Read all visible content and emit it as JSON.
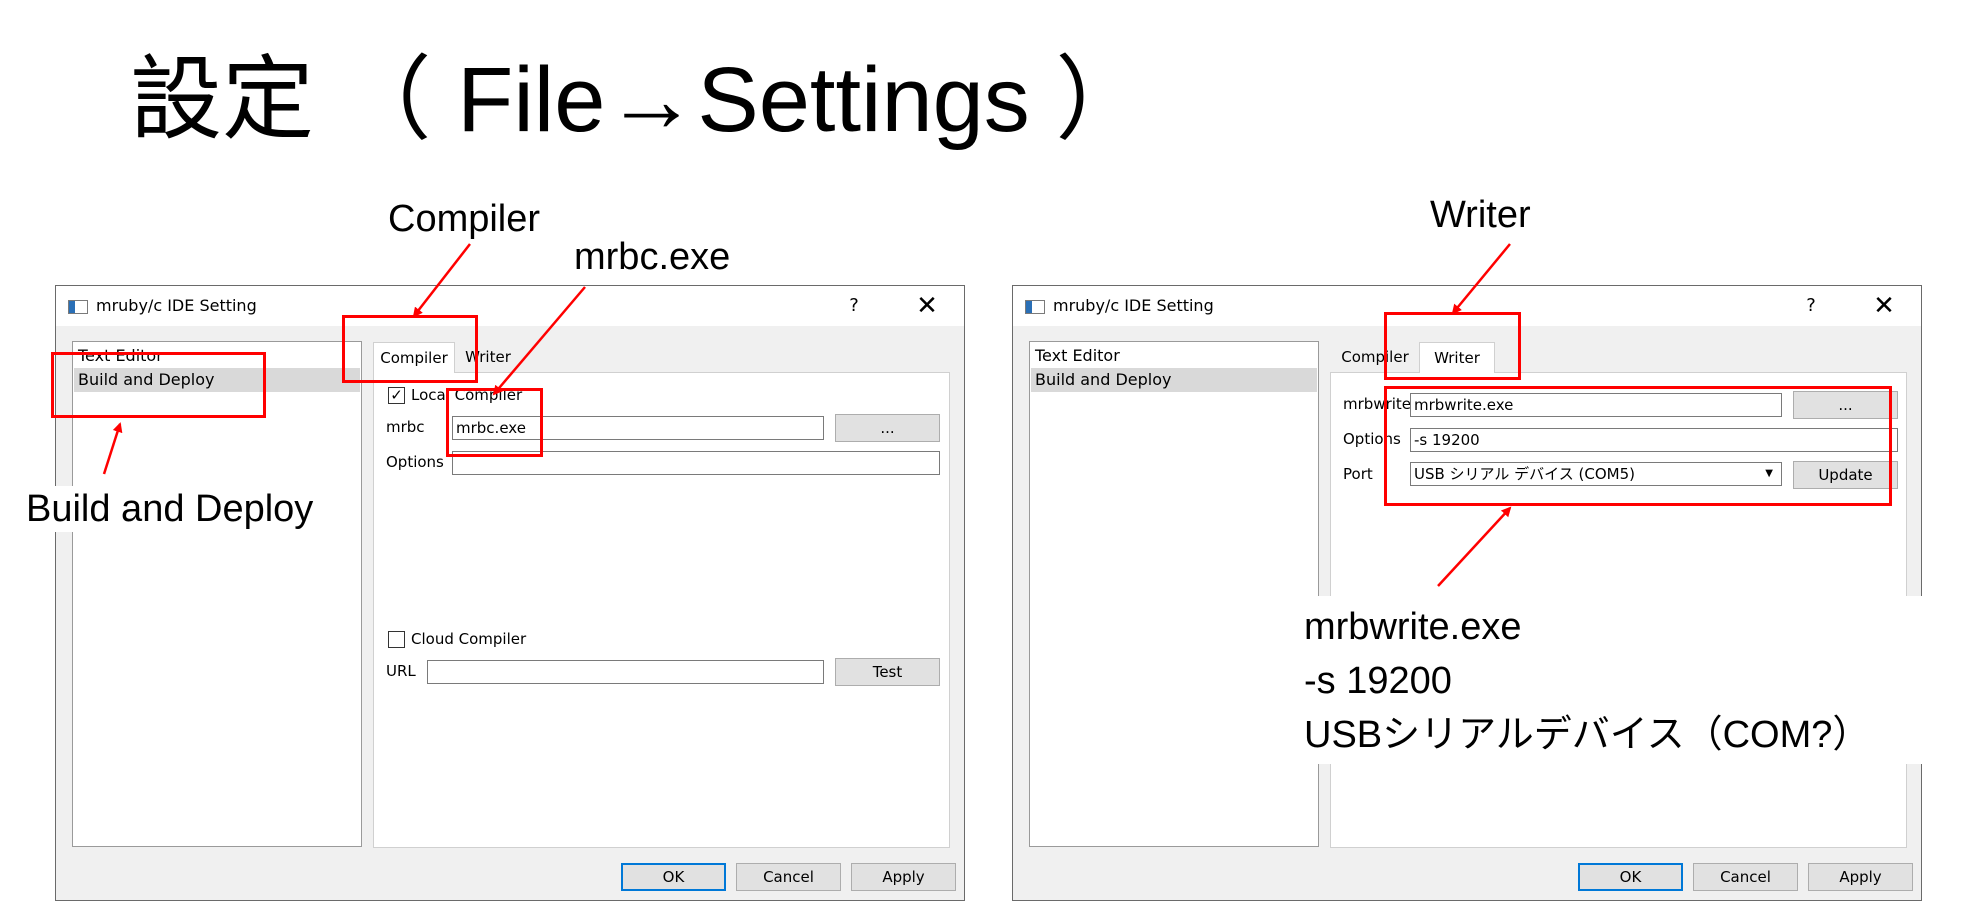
{
  "slide": {
    "title": "設定 （ File→Settings ）"
  },
  "callouts": {
    "compiler": "Compiler",
    "mrbc_exe": "mrbc.exe",
    "build_and_deploy": "Build and Deploy",
    "writer": "Writer",
    "writer_values": [
      "mrbwrite.exe",
      "-s 19200",
      "USBシリアルデバイス（COM?）"
    ]
  },
  "colors": {
    "annotation": "#ff0000",
    "default_button_border": "#0078d7",
    "selected_item": "#d9d9d9"
  },
  "left_dialog": {
    "window_title": "mruby/c IDE Setting",
    "help": "?",
    "close": "✕",
    "nav_items": [
      "Text Editor",
      "Build and Deploy"
    ],
    "tabs": [
      "Compiler",
      "Writer"
    ],
    "local_compiler": {
      "label": "Local Compiler",
      "checked": true
    },
    "mrbc_label": "mrbc",
    "mrbc_value": "mrbc.exe",
    "browse": "...",
    "options_label": "Options",
    "options_value": "",
    "cloud_compiler": {
      "label": "Cloud Compiler",
      "checked": false
    },
    "url_label": "URL",
    "url_value": "",
    "test": "Test",
    "buttons": {
      "ok": "OK",
      "cancel": "Cancel",
      "apply": "Apply"
    }
  },
  "right_dialog": {
    "window_title": "mruby/c IDE Setting",
    "help": "?",
    "close": "✕",
    "nav_items": [
      "Text Editor",
      "Build and Deploy"
    ],
    "tabs": [
      "Compiler",
      "Writer"
    ],
    "mrbwrite_label": "mrbwrite",
    "mrbwrite_value": "mrbwrite.exe",
    "browse": "...",
    "options_label": "Options",
    "options_value": "-s 19200",
    "port_label": "Port",
    "port_value": "USB シリアル デバイス (COM5)",
    "update": "Update",
    "buttons": {
      "ok": "OK",
      "cancel": "Cancel",
      "apply": "Apply"
    }
  }
}
